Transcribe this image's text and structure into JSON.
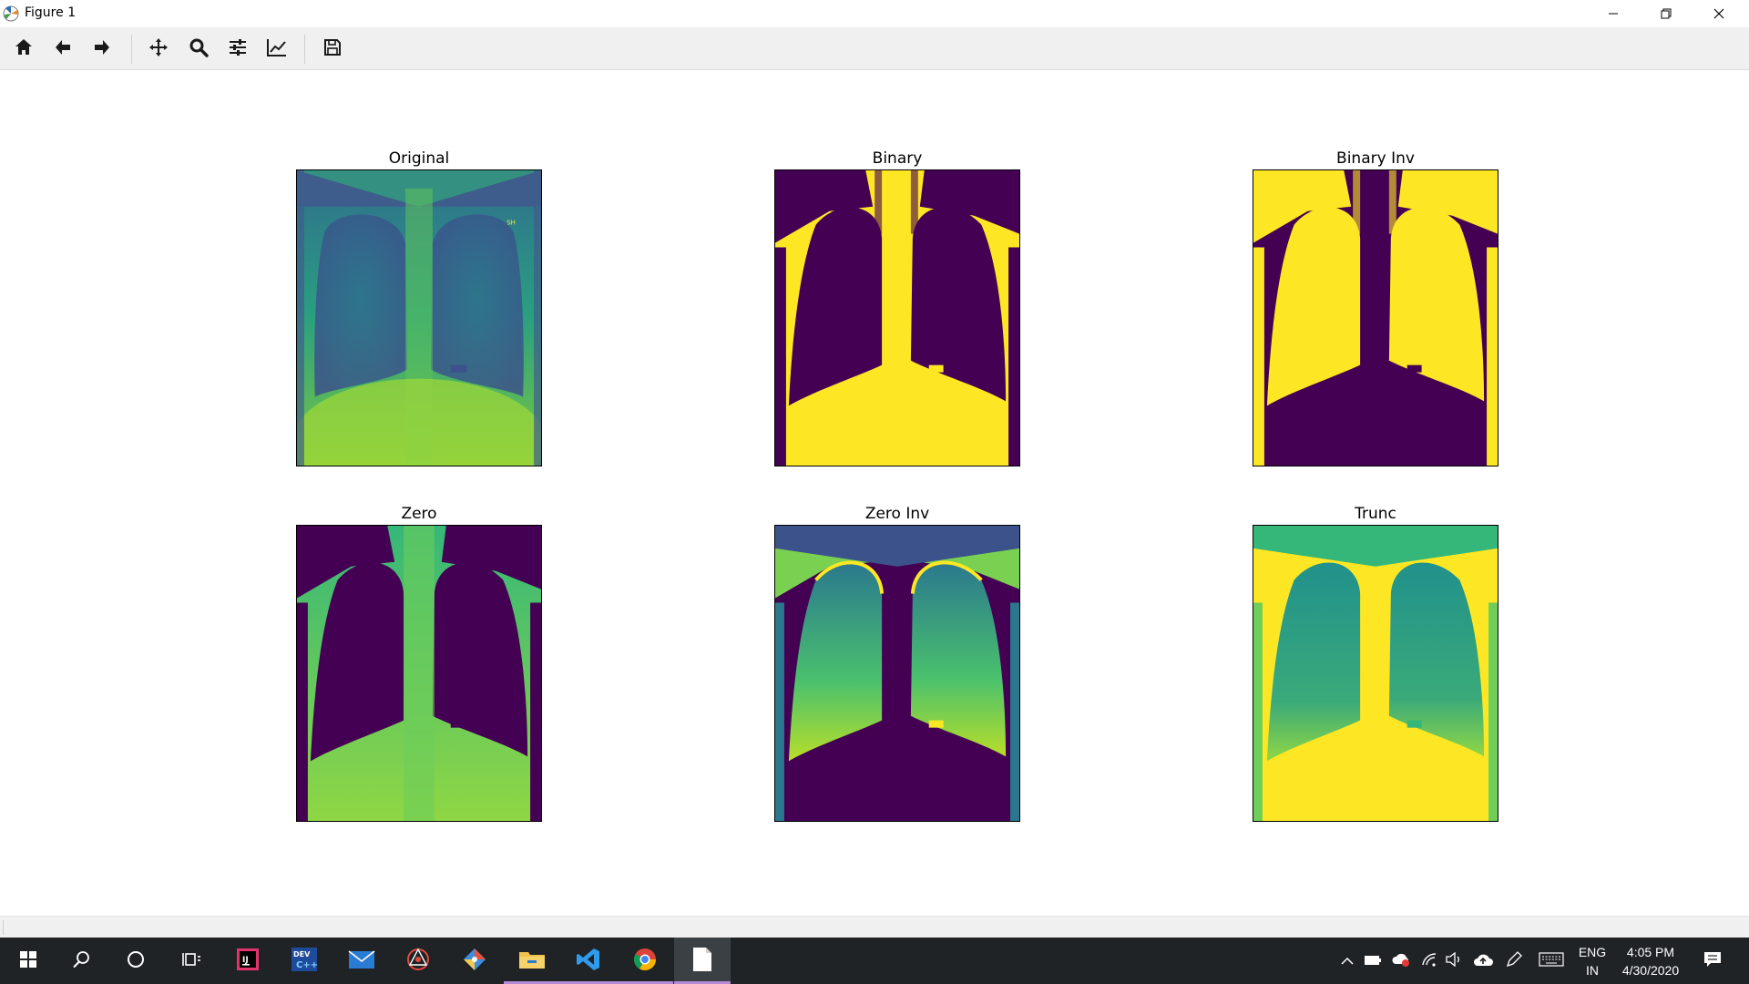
{
  "window": {
    "title": "Figure 1",
    "app_icon": "matplotlib-figure-icon",
    "controls": [
      "minimize-icon",
      "restore-icon",
      "close-icon"
    ]
  },
  "toolbar": {
    "buttons": [
      {
        "icon": "home-icon"
      },
      {
        "icon": "back-arrow-icon"
      },
      {
        "icon": "forward-arrow-icon"
      },
      {
        "icon": "pan-move-icon"
      },
      {
        "icon": "zoom-magnifier-icon"
      },
      {
        "icon": "configure-subplots-icon"
      },
      {
        "icon": "edit-axis-icon"
      },
      {
        "icon": "save-disk-icon"
      }
    ]
  },
  "figure": {
    "colormap": "viridis",
    "colors": {
      "low": "#440154",
      "mid": "#21918c",
      "high": "#fde725"
    },
    "subplots": [
      {
        "title": "Original",
        "content": "chest x-ray, viridis colormap"
      },
      {
        "title": "Binary",
        "content": "binary threshold"
      },
      {
        "title": "Binary Inv",
        "content": "inverted binary threshold"
      },
      {
        "title": "Zero",
        "content": "to-zero threshold"
      },
      {
        "title": "Zero Inv",
        "content": "inverted to-zero threshold"
      },
      {
        "title": "Trunc",
        "content": "truncated threshold"
      }
    ]
  },
  "taskbar": {
    "apps": [
      {
        "icon": "windows-start-icon"
      },
      {
        "icon": "search-icon"
      },
      {
        "icon": "cortana-circle-icon"
      },
      {
        "icon": "task-view-icon"
      },
      {
        "icon": "intellij-idea-icon"
      },
      {
        "icon": "dev-cpp-icon"
      },
      {
        "icon": "mail-icon"
      },
      {
        "icon": "network-app-icon"
      },
      {
        "icon": "git-icon"
      },
      {
        "icon": "file-explorer-icon"
      },
      {
        "icon": "vscode-icon"
      },
      {
        "icon": "chrome-icon"
      },
      {
        "icon": "document-icon"
      }
    ],
    "tray": {
      "language_line1": "ENG",
      "language_line2": "IN",
      "time": "4:05 PM",
      "date": "4/30/2020"
    }
  }
}
